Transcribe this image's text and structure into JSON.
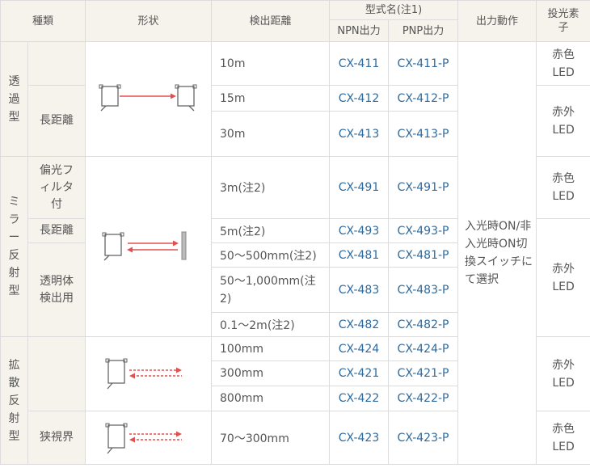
{
  "headers": {
    "kind": "種類",
    "shape": "形状",
    "distance": "検出距離",
    "model": "型式名(注1)",
    "npn": "NPN出力",
    "pnp": "PNP出力",
    "output": "出力動作",
    "emitter": "投光素子"
  },
  "groups": {
    "through": "透過型",
    "through_long": "長距離",
    "mirror": "ミラー反射型",
    "mirror_polar": "偏光フィルタ付",
    "mirror_long": "長距離",
    "mirror_trans": "透明体検出用",
    "diffuse": "拡散反射型",
    "diffuse_narrow": "狭視界"
  },
  "rows": [
    {
      "distance": "10m",
      "npn": "CX-411",
      "pnp": "CX-411-P"
    },
    {
      "distance": "15m",
      "npn": "CX-412",
      "pnp": "CX-412-P"
    },
    {
      "distance": "30m",
      "npn": "CX-413",
      "pnp": "CX-413-P"
    },
    {
      "distance": "3m(注2)",
      "npn": "CX-491",
      "pnp": "CX-491-P"
    },
    {
      "distance": "5m(注2)",
      "npn": "CX-493",
      "pnp": "CX-493-P"
    },
    {
      "distance": "50～500mm(注2)",
      "npn": "CX-481",
      "pnp": "CX-481-P"
    },
    {
      "distance": "50～1,000mm(注2)",
      "npn": "CX-483",
      "pnp": "CX-483-P"
    },
    {
      "distance": "0.1～2m(注2)",
      "npn": "CX-482",
      "pnp": "CX-482-P"
    },
    {
      "distance": "100mm",
      "npn": "CX-424",
      "pnp": "CX-424-P"
    },
    {
      "distance": "300mm",
      "npn": "CX-421",
      "pnp": "CX-421-P"
    },
    {
      "distance": "800mm",
      "npn": "CX-422",
      "pnp": "CX-422-P"
    },
    {
      "distance": "70～300mm",
      "npn": "CX-423",
      "pnp": "CX-423-P"
    }
  ],
  "output_action": "入光時ON/非入光時ON切換スイッチにて選択",
  "led": {
    "red": "赤色LED",
    "infrared": "赤外LED"
  },
  "colors": {
    "header_bg": "#f6f3ec",
    "border": "#dcdcdc",
    "model_link": "#2e6a9e",
    "beam_red": "#e05050"
  },
  "icons": {
    "through": "through-beam-sensor-icon",
    "mirror": "retroreflective-sensor-icon",
    "diffuse": "diffuse-sensor-icon",
    "diffuse_narrow": "narrow-view-sensor-icon"
  }
}
